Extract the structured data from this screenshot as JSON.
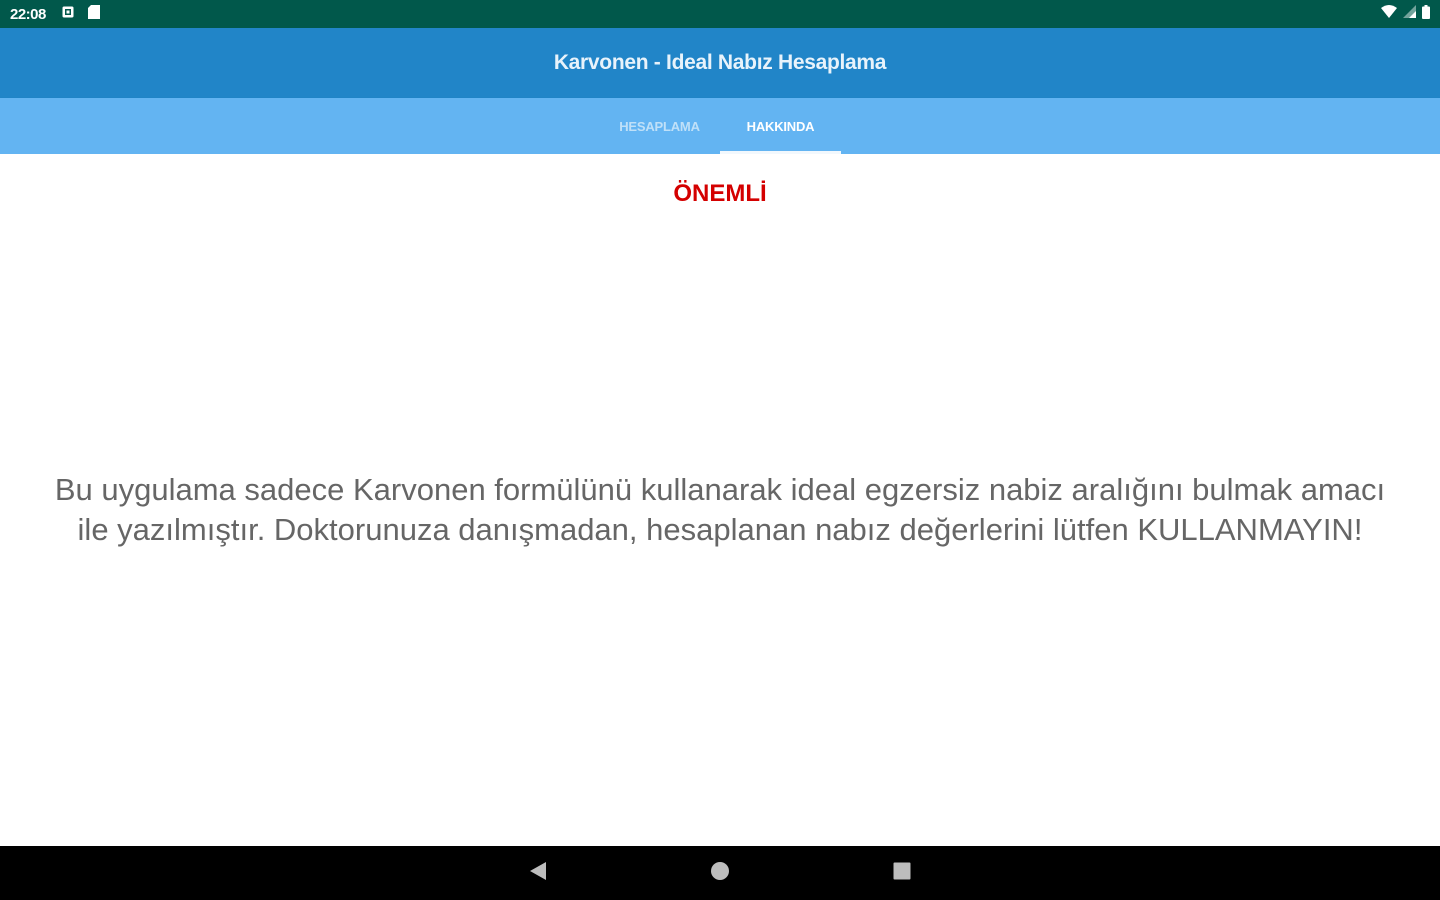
{
  "status_bar": {
    "time": "22:08",
    "icons_left": [
      "notification-icon",
      "sd-card-icon"
    ],
    "icons_right": [
      "wifi-icon",
      "signal-icon",
      "battery-icon"
    ],
    "background": "#01584b"
  },
  "app_bar": {
    "title": "Karvonen - Ideal Nabız Hesaplama",
    "background": "#2185c8"
  },
  "tabs": [
    {
      "label": "HESAPLAMA",
      "active": false
    },
    {
      "label": "HAKKINDA",
      "active": true
    }
  ],
  "tab_bar_background": "#63b4f2",
  "content": {
    "title": "ÖNEMLİ",
    "title_color": "#d40000",
    "disclaimer": "Bu uygulama sadece Karvonen formülünü kullanarak ideal egzersiz nabiz aralığını bulmak amacı ile yazılmıştır. Doktorunuza danışmadan, hesaplanan nabız değerlerini lütfen KULLANMAYIN!"
  },
  "nav_bar": {
    "buttons": [
      "back-icon",
      "home-icon",
      "recents-icon"
    ]
  }
}
